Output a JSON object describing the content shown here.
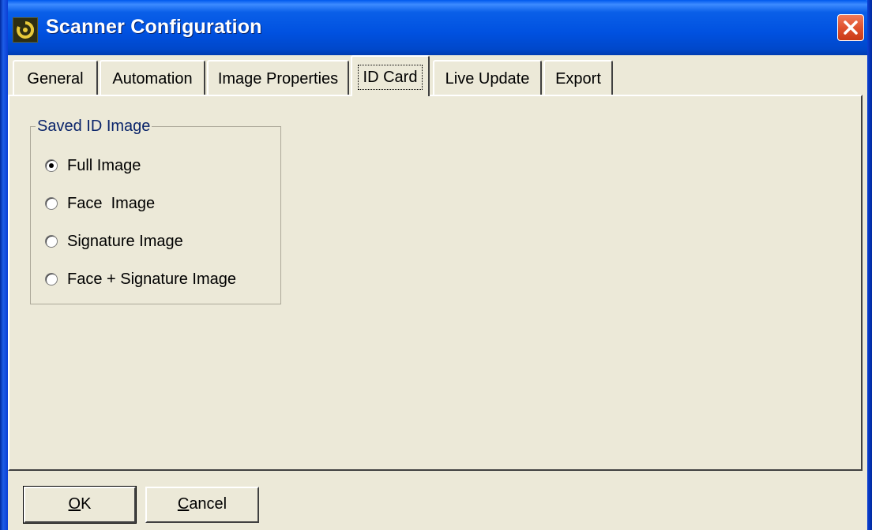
{
  "window": {
    "title": "Scanner Configuration",
    "close_icon": "close-icon",
    "app_icon": "app-logo-icon"
  },
  "tabs": [
    {
      "label": "General",
      "active": false
    },
    {
      "label": "Automation",
      "active": false
    },
    {
      "label": "Image Properties",
      "active": false
    },
    {
      "label": "ID Card",
      "active": true
    },
    {
      "label": "Live Update",
      "active": false
    },
    {
      "label": "Export",
      "active": false
    }
  ],
  "groupbox": {
    "title": "Saved ID Image",
    "options": [
      {
        "label": "Full Image",
        "selected": true
      },
      {
        "label": "Face  Image",
        "selected": false
      },
      {
        "label": "Signature Image",
        "selected": false
      },
      {
        "label": "Face + Signature Image",
        "selected": false
      }
    ]
  },
  "buttons": {
    "ok_mnemonic": "O",
    "ok_rest": "K",
    "cancel_mnemonic": "C",
    "cancel_rest": "ancel"
  },
  "colors": {
    "titlebar": "#0051e0",
    "face": "#ece9d8",
    "close": "#e0522e",
    "group_title": "#0a246a"
  }
}
